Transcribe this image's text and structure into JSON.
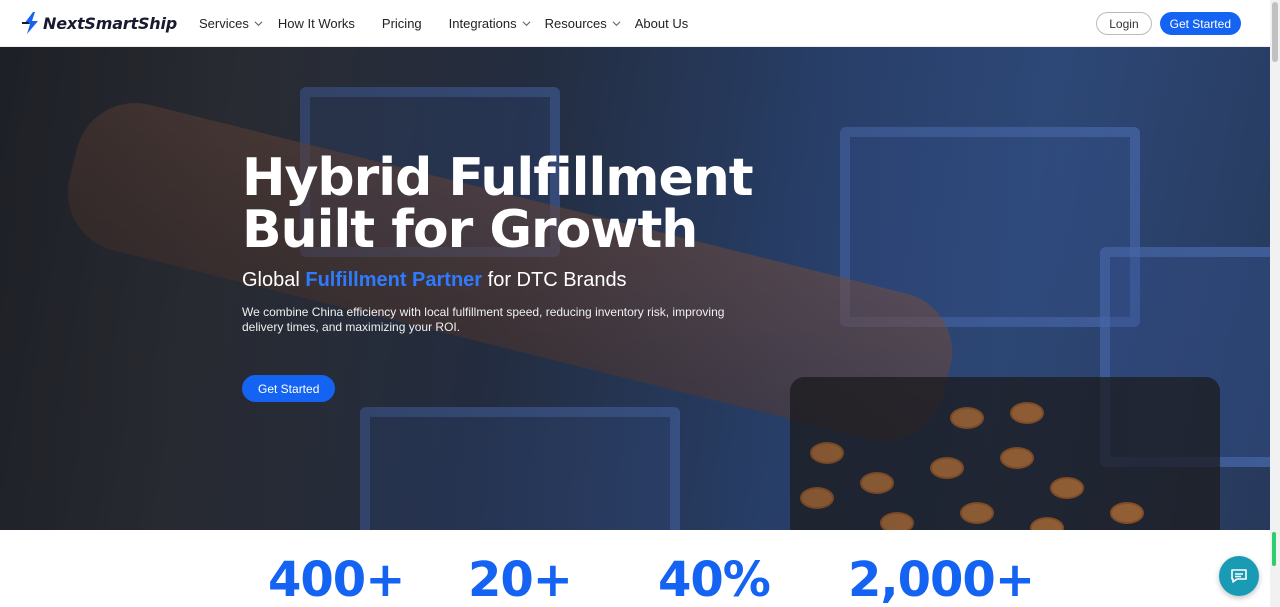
{
  "brand": {
    "name": "NextSmartShip",
    "accent": "#1463f3"
  },
  "nav": {
    "items": [
      {
        "label": "Services",
        "has_dropdown": true
      },
      {
        "label": "How It Works",
        "has_dropdown": false
      },
      {
        "label": "Pricing",
        "has_dropdown": false
      },
      {
        "label": "Integrations",
        "has_dropdown": true
      },
      {
        "label": "Resources",
        "has_dropdown": true
      },
      {
        "label": "About Us",
        "has_dropdown": false
      }
    ],
    "login_label": "Login",
    "cta_label": "Get Started"
  },
  "hero": {
    "title_line1": "Hybrid Fulfillment",
    "title_line2": "Built for Growth",
    "subtitle_prefix": "Global ",
    "subtitle_accent": "Fulfillment Partner",
    "subtitle_suffix": " for DTC Brands",
    "description": "We combine China efficiency with local fulfillment speed, reducing inventory risk, improving delivery times, and maximizing your ROI.",
    "cta_label": "Get Started"
  },
  "stats": [
    {
      "value": "400+"
    },
    {
      "value": "20+"
    },
    {
      "value": "40%"
    },
    {
      "value": "2,000+"
    }
  ],
  "chat": {
    "icon": "chat-icon"
  }
}
